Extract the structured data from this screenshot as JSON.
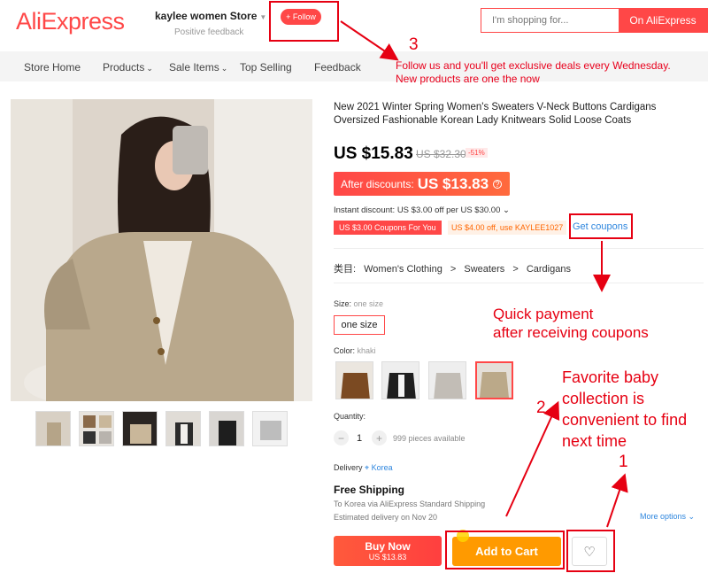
{
  "header": {
    "logo": "AliExpress",
    "store_name": "kaylee women Store",
    "store_sub": "Positive feedback",
    "follow_label": "+ Follow",
    "search_placeholder": "I'm shopping for...",
    "search_button": "On AliExpress"
  },
  "nav": {
    "items": [
      "Store Home",
      "Products",
      "Sale Items",
      "Top Selling",
      "Feedback"
    ]
  },
  "annotations": {
    "promo_line1": "Follow us and you'll get exclusive deals every Wednesday.",
    "promo_line2": "New products are one the now",
    "num1": "1",
    "num2": "2",
    "num3": "3",
    "quick_line1": "Quick payment",
    "quick_line2": "after receiving coupons",
    "fav_line1": "Favorite baby",
    "fav_line2": "collection is",
    "fav_line3": "convenient to find",
    "fav_line4": "next time"
  },
  "product": {
    "title": "New 2021 Winter Spring Women's Sweaters V-Neck Buttons Cardigans Oversized Fashionable Korean Lady Knitwears Solid Loose Coats",
    "price": "US $15.83",
    "old_price": "US $32.30",
    "discount": "-51%",
    "after_discount_label": "After discounts:",
    "after_discount_price": "US $13.83",
    "instant_discount": "Instant discount: US $3.00 off per US $30.00 ⌄",
    "coupon1": "US $3.00 Coupons For You",
    "coupon2": "US $4.00 off, use KAYLEE1027",
    "get_coupons": "Get coupons",
    "category_label": "类目:",
    "category_path": [
      "Women's Clothing",
      "Sweaters",
      "Cardigans"
    ],
    "category_sep": ">",
    "size_label": "Size:",
    "size_value": "one size",
    "size_option": "one size",
    "color_label": "Color:",
    "color_value": "khaki",
    "quantity_label": "Quantity:",
    "quantity": "1",
    "qty_minus": "−",
    "qty_plus": "+",
    "available": "999 pieces available",
    "delivery_label": "Delivery",
    "delivery_country": "Korea",
    "free_shipping": "Free Shipping",
    "ship_via": "To Korea via AliExpress Standard Shipping",
    "ship_est": "Estimated delivery on Nov 20",
    "more_options": "More options",
    "buy_now": "Buy Now",
    "buy_now_price": "US $13.83",
    "add_to_cart": "Add to Cart"
  },
  "colors": {
    "brand": "#ff4747",
    "annotation": "#e60012",
    "cart": "#ff9a00"
  }
}
